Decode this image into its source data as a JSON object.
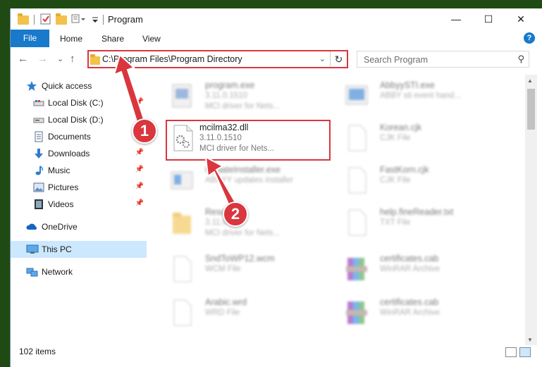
{
  "window": {
    "title": "Program"
  },
  "ribbon": {
    "file": "File",
    "home": "Home",
    "share": "Share",
    "view": "View",
    "help": "?"
  },
  "nav": {
    "back": "←",
    "forward": "→",
    "recent": "⌄",
    "up": "↑",
    "address": "C:\\Program Files\\Program Directory",
    "address_chevron": "⌄",
    "refresh": "↻",
    "search_placeholder": "Search Program",
    "search_icon": "⚲"
  },
  "sidebar": {
    "items": [
      {
        "label": "Quick access",
        "icon": "star-icon",
        "pin": ""
      },
      {
        "label": "Local Disk (C:)",
        "icon": "drive-icon",
        "pin": "📌"
      },
      {
        "label": "Local Disk (D:)",
        "icon": "drive-icon",
        "pin": ""
      },
      {
        "label": "Documents",
        "icon": "documents-icon",
        "pin": "📌"
      },
      {
        "label": "Downloads",
        "icon": "download-icon",
        "pin": "📌"
      },
      {
        "label": "Music",
        "icon": "music-icon",
        "pin": "📌"
      },
      {
        "label": "Pictures",
        "icon": "pictures-icon",
        "pin": "📌"
      },
      {
        "label": "Videos",
        "icon": "videos-icon",
        "pin": "📌"
      },
      {
        "label": "OneDrive",
        "icon": "cloud-icon",
        "pin": ""
      },
      {
        "label": "This PC",
        "icon": "pc-icon",
        "pin": ""
      },
      {
        "label": "Network",
        "icon": "network-icon",
        "pin": ""
      }
    ]
  },
  "files": {
    "highlighted": {
      "name": "mcilma32.dll",
      "version": "3.11.0.1510",
      "description": "MCI driver for Nets..."
    },
    "blurred": [
      {
        "name": "program.exe",
        "l2": "3.11.0.1510",
        "l3": "MCI driver for Nets..."
      },
      {
        "name": "AbbyySTI.exe",
        "l2": "ABBY sti event hand...",
        "l3": ""
      },
      {
        "name": "Korean.cjk",
        "l2": "CJK File",
        "l3": ""
      },
      {
        "name": "UpdateInstaller.exe",
        "l2": "ABBYY updates installer",
        "l3": ""
      },
      {
        "name": "FastKorn.cjk",
        "l2": "CJK File",
        "l3": ""
      },
      {
        "name": "Resco...",
        "l2": "3.11.0",
        "l3": "MCI driver for Nets..."
      },
      {
        "name": "help.fineReader.txt",
        "l2": "TXT File",
        "l3": ""
      },
      {
        "name": "SndToWP12.wcm",
        "l2": "WCM File",
        "l3": ""
      },
      {
        "name": "certificates.cab",
        "l2": "WinRAR Archive",
        "l3": ""
      },
      {
        "name": "Arabic.wrd",
        "l2": "WRD File",
        "l3": ""
      },
      {
        "name": "certificates.cab",
        "l2": "WinRAR Archive",
        "l3": ""
      }
    ]
  },
  "status": {
    "count": "102 items"
  },
  "annotations": {
    "step1": "1",
    "step2": "2"
  },
  "colors": {
    "accent": "#1979ca",
    "annotation": "#d9363e",
    "selected": "#cce8ff"
  }
}
